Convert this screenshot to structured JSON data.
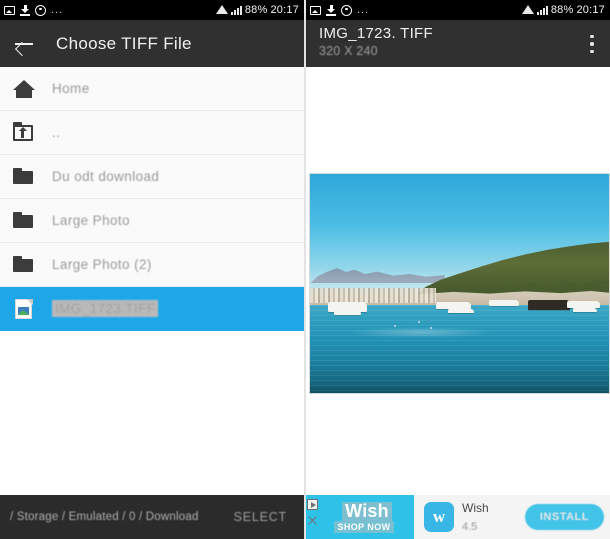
{
  "status_bar": {
    "icons": [
      "screenshot-icon",
      "download-icon",
      "alarm-icon"
    ],
    "overflow_dots": "...",
    "battery": "88%",
    "time": "20:17",
    "wifi_icon": "wifi-icon",
    "signal_icon": "signal-icon"
  },
  "left_panel": {
    "appbar": {
      "back_icon": "back-arrow-icon",
      "title": "Choose TIFF File"
    },
    "files": [
      {
        "icon": "home-icon",
        "label": "Home",
        "selected": false
      },
      {
        "icon": "folder-up-icon",
        "label": "..",
        "selected": false
      },
      {
        "icon": "folder-icon",
        "label": "Du odt download",
        "selected": false
      },
      {
        "icon": "folder-icon",
        "label": "Large Photo",
        "selected": false
      },
      {
        "icon": "folder-icon",
        "label": "Large Photo (2)",
        "selected": false
      },
      {
        "icon": "image-file-icon",
        "label": "IMG_1723.TIFF",
        "selected": true
      }
    ],
    "bottom_bar": {
      "path": "/ Storage / Emulated / 0 / Download",
      "select_label": "SELECT"
    }
  },
  "right_panel": {
    "appbar": {
      "title": "IMG_1723. TIFF",
      "subtitle": "320 X 240",
      "overflow_icon": "overflow-menu-icon"
    },
    "photo": {
      "alt": "Coastal seascape with boats moored near a rocky shoreline"
    },
    "ad": {
      "badge_icon": "ad-choices-icon",
      "close_icon": "close-icon",
      "wordmark": "Wish",
      "cta": "SHOP NOW",
      "app_icon_glyph": "w",
      "app_name": "Wish",
      "rating": "4.5",
      "install_label": "INSTALL"
    }
  },
  "colors": {
    "accent_selected": "#1ea7e8",
    "appbar_bg": "#303030",
    "statusbar_bg": "#000000",
    "ad_cyan": "#2fc2e8",
    "list_bg": "#fafafa"
  }
}
